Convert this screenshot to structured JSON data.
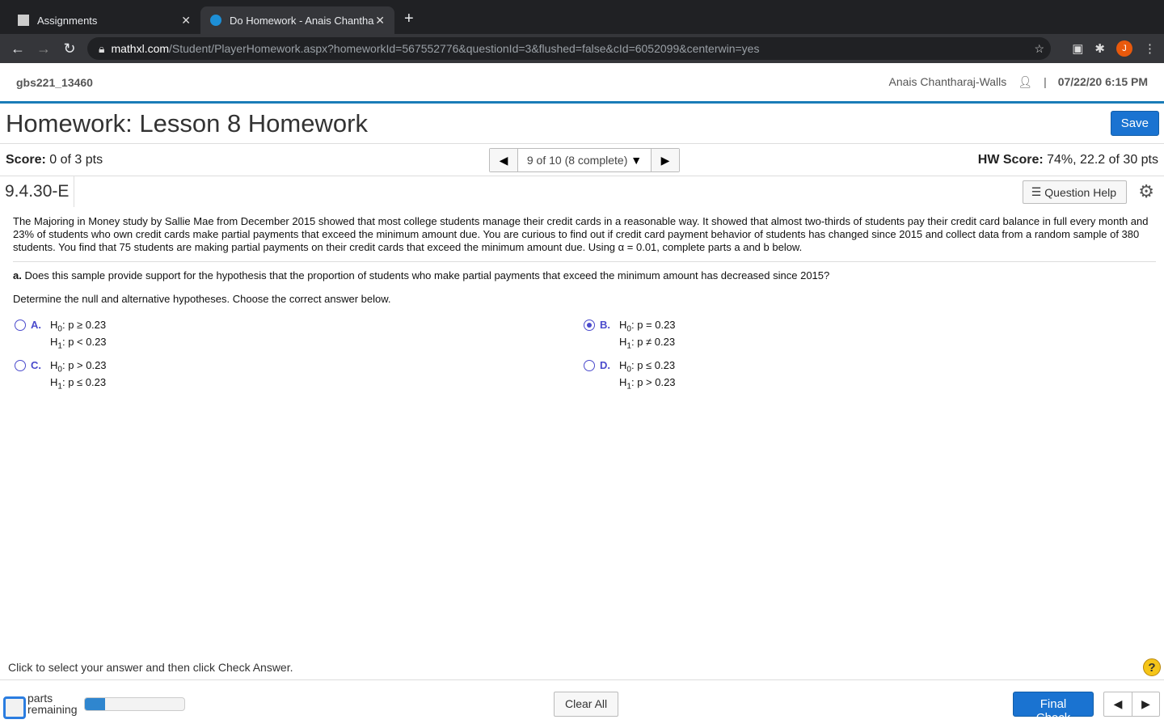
{
  "browser": {
    "tabs": [
      {
        "label": "Assignments",
        "active": false
      },
      {
        "label": "Do Homework - Anais Chantha",
        "active": true
      }
    ],
    "url_host": "mathxl.com",
    "url_path": "/Student/PlayerHomework.aspx?homeworkId=567552776&questionId=3&flushed=false&cId=6052099&centerwin=yes",
    "profile_initial": "J"
  },
  "header": {
    "course_id": "gbs221_13460",
    "user": "Anais Chantharaj-Walls",
    "separator": "|",
    "datetime": "07/22/20 6:15 PM"
  },
  "title": "Homework: Lesson 8 Homework",
  "save_label": "Save",
  "score": {
    "label": "Score:",
    "value": "0 of 3 pts"
  },
  "question_nav": {
    "current": "9 of 10 (8 complete)"
  },
  "hw_score": {
    "label": "HW Score:",
    "value": "74%, 22.2 of 30 pts"
  },
  "question_id": "9.4.30-E",
  "question_help_label": "Question Help",
  "question": {
    "stem": "The Majoring in Money study by Sallie Mae from December 2015 showed that most college students manage their credit cards in a reasonable way. It showed that almost two-thirds of students pay their credit card balance in full every month and 23% of students who own credit cards make partial payments that exceed the minimum amount due. You are curious to find out if credit card payment behavior of students has changed since 2015 and collect data from a random sample of 380 students. You find that 75 students are making partial payments on their credit cards that exceed the minimum amount due. Using α = 0.01, complete parts a and b below.",
    "part_a_label": "a.",
    "part_a": " Does this sample provide support for the hypothesis that the proportion of students who make partial payments that exceed the minimum amount has decreased since 2015?",
    "instruction": "Determine the null and alternative hypotheses. Choose the correct answer below.",
    "choices": [
      {
        "letter": "A.",
        "h0": "p ≥ 0.23",
        "h1": "p < 0.23",
        "selected": false
      },
      {
        "letter": "B.",
        "h0": "p = 0.23",
        "h1": "p ≠ 0.23",
        "selected": true
      },
      {
        "letter": "C.",
        "h0": "p > 0.23",
        "h1": "p ≤ 0.23",
        "selected": false
      },
      {
        "letter": "D.",
        "h0": "p ≤ 0.23",
        "h1": "p > 0.23",
        "selected": false
      }
    ]
  },
  "footer": {
    "instruction": "Click to select your answer and then click Check Answer.",
    "parts_line1": "parts",
    "parts_line2": "remaining",
    "progress_percent": 20,
    "clear_all": "Clear All",
    "final_check": "Final Check"
  },
  "colors": {
    "accent": "#1a73d1",
    "choice": "#4a4acc",
    "rule": "#1a7cb8"
  }
}
